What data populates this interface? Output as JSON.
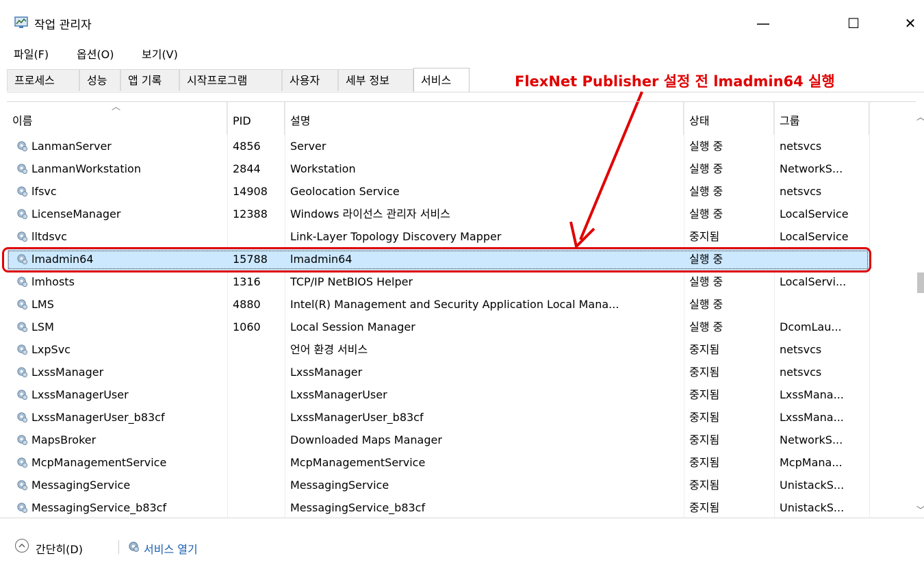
{
  "window": {
    "title": "작업 관리자",
    "minimize_icon": "minimize-icon",
    "maximize_icon": "maximize-icon",
    "close_icon": "close-icon",
    "minimize_glyph": "—",
    "maximize_glyph": "☐",
    "close_glyph": "✕"
  },
  "menu": [
    "파일(F)",
    "옵션(O)",
    "보기(V)"
  ],
  "tabs": [
    "프로세스",
    "성능",
    "앱 기록",
    "시작프로그램",
    "사용자",
    "세부 정보",
    "서비스"
  ],
  "active_tab": "서비스",
  "annotation": {
    "text": "FlexNet Publisher 설정 전 lmadmin64 실행",
    "color": "#e00000"
  },
  "columns": {
    "name": "이름",
    "pid": "PID",
    "desc": "설명",
    "status": "상태",
    "group": "그룹"
  },
  "rows": [
    {
      "name": "LanmanServer",
      "pid": "4856",
      "desc": "Server",
      "status": "실행 중",
      "group": "netsvcs"
    },
    {
      "name": "LanmanWorkstation",
      "pid": "2844",
      "desc": "Workstation",
      "status": "실행 중",
      "group": "NetworkS..."
    },
    {
      "name": "lfsvc",
      "pid": "14908",
      "desc": "Geolocation Service",
      "status": "실행 중",
      "group": "netsvcs"
    },
    {
      "name": "LicenseManager",
      "pid": "12388",
      "desc": "Windows 라이선스 관리자 서비스",
      "status": "실행 중",
      "group": "LocalService"
    },
    {
      "name": "lltdsvc",
      "pid": "",
      "desc": "Link-Layer Topology Discovery Mapper",
      "status": "중지됨",
      "group": "LocalService"
    },
    {
      "name": "lmadmin64",
      "pid": "15788",
      "desc": "lmadmin64",
      "status": "실행 중",
      "group": "",
      "selected": true
    },
    {
      "name": "lmhosts",
      "pid": "1316",
      "desc": "TCP/IP NetBIOS Helper",
      "status": "실행 중",
      "group": "LocalServi..."
    },
    {
      "name": "LMS",
      "pid": "4880",
      "desc": "Intel(R) Management and Security Application Local Mana...",
      "status": "실행 중",
      "group": ""
    },
    {
      "name": "LSM",
      "pid": "1060",
      "desc": "Local Session Manager",
      "status": "실행 중",
      "group": "DcomLau..."
    },
    {
      "name": "LxpSvc",
      "pid": "",
      "desc": "언어 환경 서비스",
      "status": "중지됨",
      "group": "netsvcs"
    },
    {
      "name": "LxssManager",
      "pid": "",
      "desc": "LxssManager",
      "status": "중지됨",
      "group": "netsvcs"
    },
    {
      "name": "LxssManagerUser",
      "pid": "",
      "desc": "LxssManagerUser",
      "status": "중지됨",
      "group": "LxssMana..."
    },
    {
      "name": "LxssManagerUser_b83cf",
      "pid": "",
      "desc": "LxssManagerUser_b83cf",
      "status": "중지됨",
      "group": "LxssMana..."
    },
    {
      "name": "MapsBroker",
      "pid": "",
      "desc": "Downloaded Maps Manager",
      "status": "중지됨",
      "group": "NetworkS..."
    },
    {
      "name": "McpManagementService",
      "pid": "",
      "desc": "McpManagementService",
      "status": "중지됨",
      "group": "McpMana..."
    },
    {
      "name": "MessagingService",
      "pid": "",
      "desc": "MessagingService",
      "status": "중지됨",
      "group": "UnistackS..."
    },
    {
      "name": "MessagingService_b83cf",
      "pid": "",
      "desc": "MessagingService_b83cf",
      "status": "중지됨",
      "group": "UnistackS..."
    }
  ],
  "footer": {
    "collapse_label": "간단히(D)",
    "open_services_label": "서비스 열기",
    "link_color": "#1a5fb4"
  }
}
